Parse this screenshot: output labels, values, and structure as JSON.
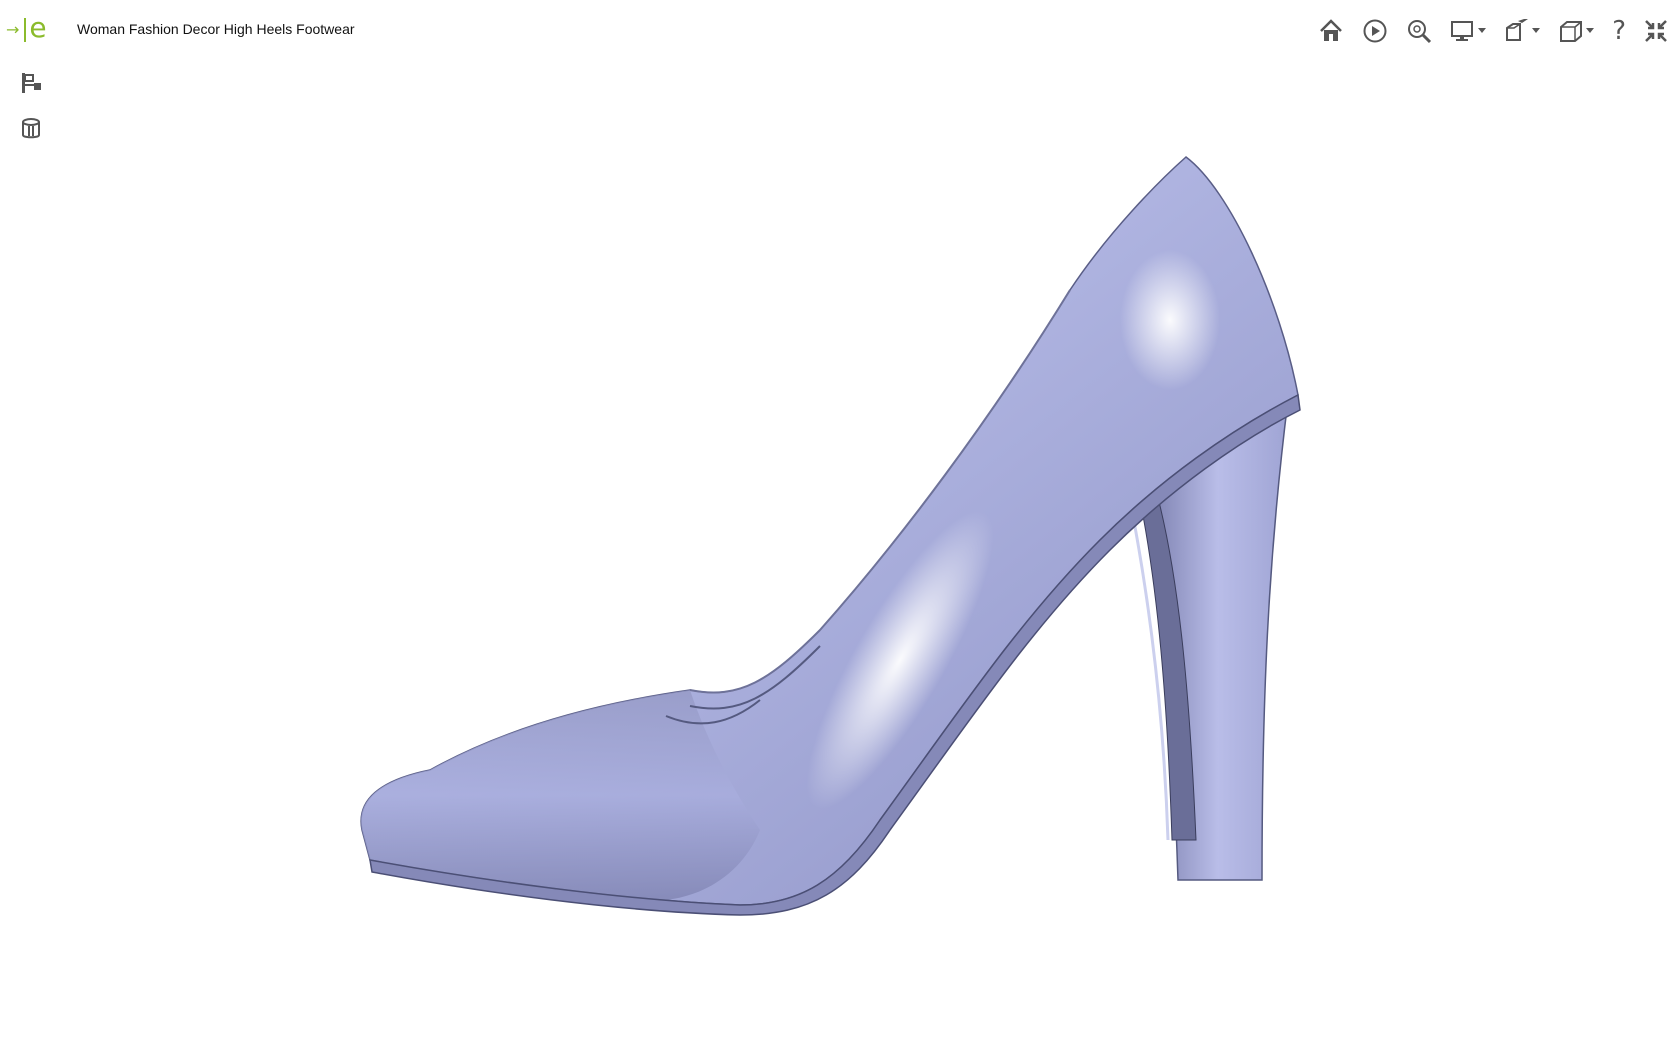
{
  "app": {
    "logo_arrow": "→",
    "logo_letter": "e",
    "title": "Woman Fashion Decor High Heels Footwear"
  },
  "left_tools": [
    {
      "icon": "model-tree-icon"
    },
    {
      "icon": "database-layers-icon"
    }
  ],
  "toolbar": [
    {
      "icon": "home-icon"
    },
    {
      "icon": "play-icon"
    },
    {
      "icon": "zoom-fit-icon"
    },
    {
      "icon": "display-mode-icon",
      "dropdown": true
    },
    {
      "icon": "explode-view-icon",
      "dropdown": true
    },
    {
      "icon": "standard-views-icon",
      "dropdown": true
    },
    {
      "icon": "help-icon",
      "label": "?"
    },
    {
      "icon": "exit-fullscreen-icon"
    }
  ],
  "viewport": {
    "model": "high-heel-shoe",
    "colors": {
      "shoe_light": "#d6d9f2",
      "shoe_mid": "#a7acd6",
      "shoe_dark": "#6f7399",
      "accent": "#8bbb2c",
      "icon": "#555555"
    }
  }
}
